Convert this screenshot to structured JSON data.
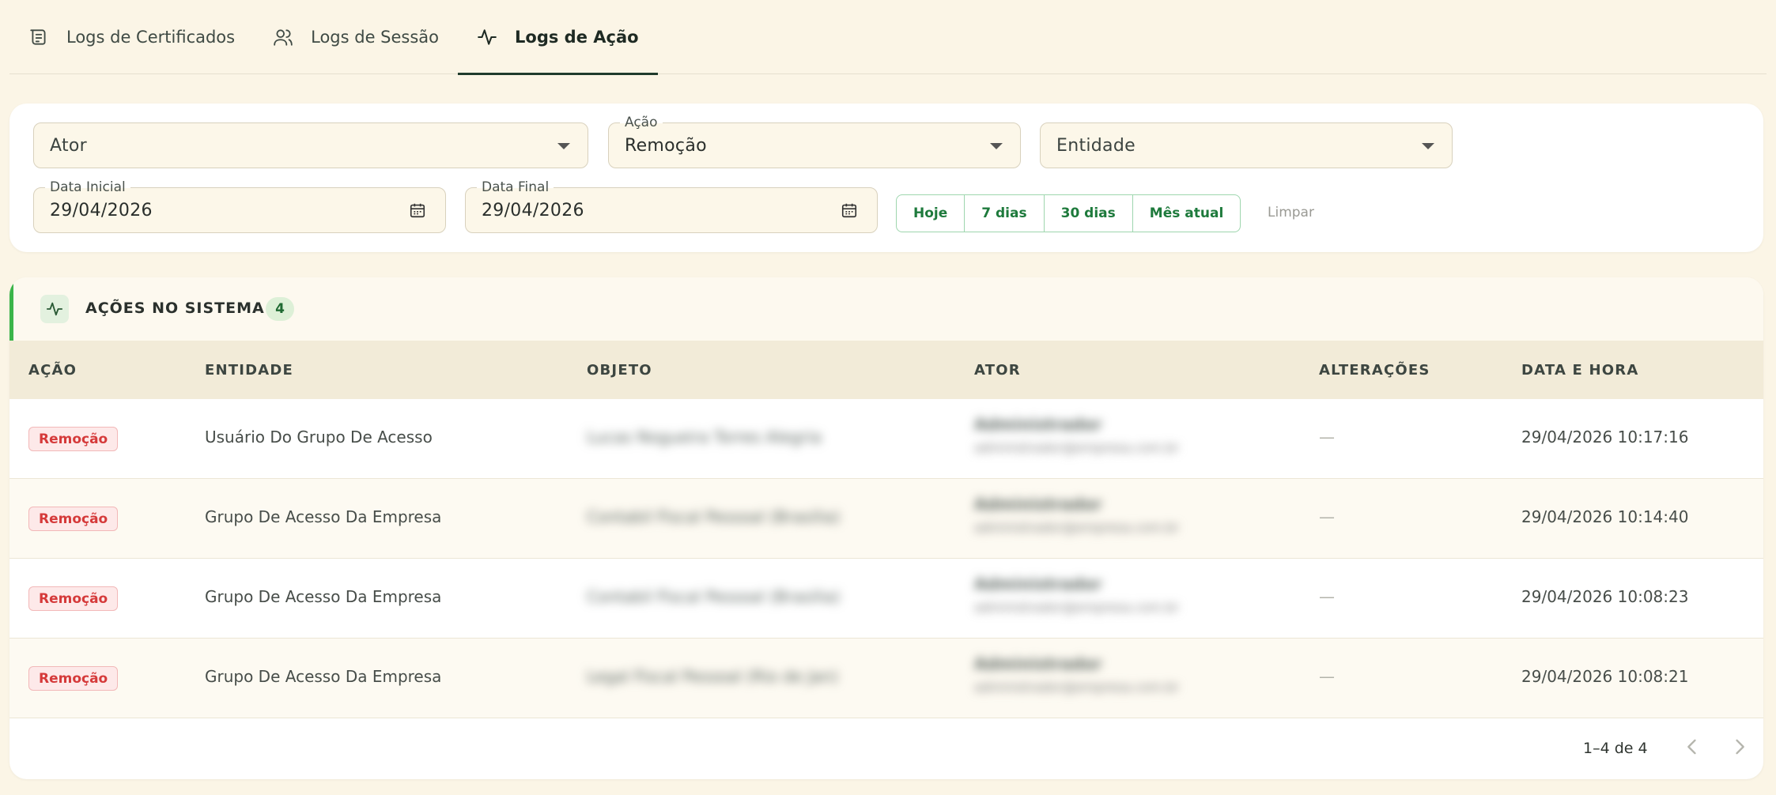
{
  "tabs": [
    {
      "label": "Logs de Certificados",
      "icon": "certificate-icon"
    },
    {
      "label": "Logs de Sessão",
      "icon": "users-icon"
    },
    {
      "label": "Logs de Ação",
      "icon": "activity-icon",
      "active": true
    }
  ],
  "filters": {
    "actor": {
      "placeholder": "Ator"
    },
    "action": {
      "label": "Ação",
      "value": "Remoção"
    },
    "entity": {
      "placeholder": "Entidade"
    },
    "start_date": {
      "label": "Data Inicial",
      "value": "29/04/2026"
    },
    "end_date": {
      "label": "Data Final",
      "value": "29/04/2026"
    },
    "quick": [
      "Hoje",
      "7 dias",
      "30 dias",
      "Mês atual"
    ],
    "clear": "Limpar"
  },
  "table": {
    "title": "AÇÕES NO SISTEMA",
    "count": "4",
    "columns": [
      "AÇÃO",
      "ENTIDADE",
      "OBJETO",
      "ATOR",
      "ALTERAÇÕES",
      "DATA E HORA"
    ],
    "rows": [
      {
        "action": "Remoção",
        "entity": "Usuário Do Grupo De Acesso",
        "object": "Lucas Nogueira Torres Alegria",
        "actor_name": "Administrador",
        "actor_email": "administrador@empresa.com.br",
        "changes": "—",
        "datetime": "29/04/2026 10:17:16"
      },
      {
        "action": "Remoção",
        "entity": "Grupo De Acesso Da Empresa",
        "object": "Contabil Fiscal Pessoal (Brasilia)",
        "actor_name": "Administrador",
        "actor_email": "administrador@empresa.com.br",
        "changes": "—",
        "datetime": "29/04/2026 10:14:40"
      },
      {
        "action": "Remoção",
        "entity": "Grupo De Acesso Da Empresa",
        "object": "Contabil Fiscal Pessoal (Brasilia)",
        "actor_name": "Administrador",
        "actor_email": "administrador@empresa.com.br",
        "changes": "—",
        "datetime": "29/04/2026 10:08:23"
      },
      {
        "action": "Remoção",
        "entity": "Grupo De Acesso Da Empresa",
        "object": "Legal Fiscal Pessoal (Rio de Jan)",
        "actor_name": "Administrador",
        "actor_email": "administrador@empresa.com.br",
        "changes": "—",
        "datetime": "29/04/2026 10:08:21"
      }
    ]
  },
  "pagination": {
    "info": "1–4 de 4"
  },
  "colors": {
    "accent": "#3bb54a",
    "danger": "#d53a3a",
    "background": "#fbf5e6"
  }
}
